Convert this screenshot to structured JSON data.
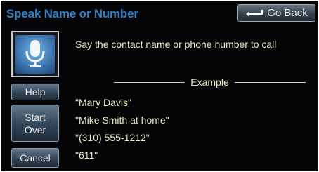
{
  "header": {
    "title": "Speak Name or Number",
    "back_label": "Go Back"
  },
  "sidebar": {
    "help_label": "Help",
    "start_over_line1": "Start",
    "start_over_line2": "Over",
    "cancel_label": "Cancel"
  },
  "main": {
    "instruction": "Say the contact name or phone number to call",
    "example_label": "Example",
    "examples": [
      "\"Mary Davis\"",
      "\"Mike Smith at home\"",
      "\"(310) 555-1212\"",
      "\"611\""
    ]
  },
  "colors": {
    "title": "#2f82c8",
    "text": "#eceac4",
    "background": "#050507",
    "mic": "#3f78b4"
  },
  "icons": {
    "back": "return-arrow-icon",
    "mic": "microphone-icon"
  }
}
